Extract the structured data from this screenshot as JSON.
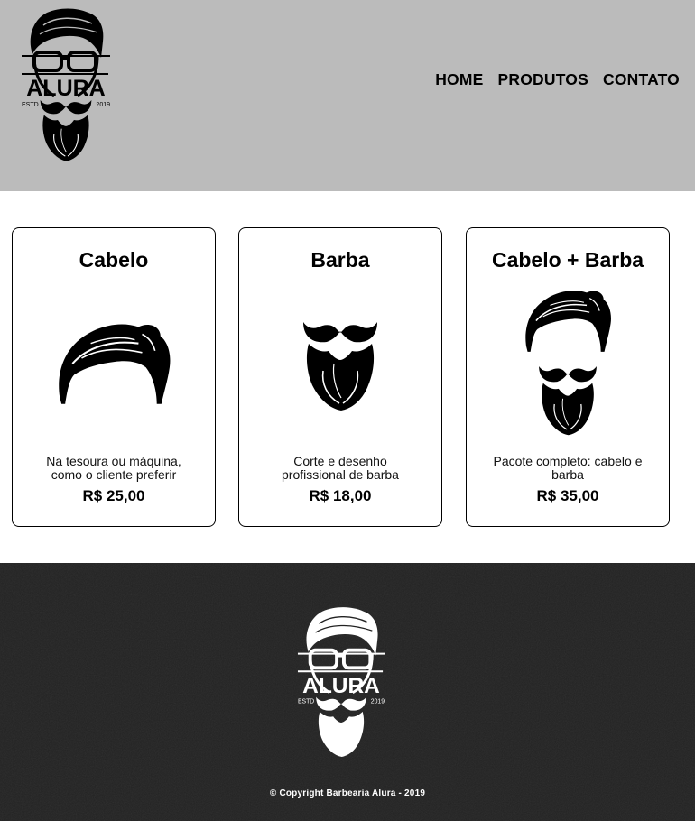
{
  "header": {
    "logo": {
      "brand": "ALURA",
      "estd_label": "ESTD",
      "year": "2019"
    },
    "nav": [
      {
        "label": "HOME"
      },
      {
        "label": "PRODUTOS"
      },
      {
        "label": "CONTATO"
      }
    ]
  },
  "products": [
    {
      "title": "Cabelo",
      "icon": "hair-icon",
      "description": "Na tesoura ou máquina, como o cliente preferir",
      "price": "R$ 25,00"
    },
    {
      "title": "Barba",
      "icon": "beard-icon",
      "description": "Corte e desenho profissional de barba",
      "price": "R$ 18,00"
    },
    {
      "title": "Cabelo + Barba",
      "icon": "hair-and-beard-icon",
      "description": "Pacote completo: cabelo e barba",
      "price": "R$ 35,00"
    }
  ],
  "footer": {
    "logo": {
      "brand": "ALURA",
      "estd_label": "ESTD",
      "year": "2019"
    },
    "copyright": "© Copyright Barbearia Alura - 2019"
  },
  "colors": {
    "header_bg": "#bbbbbb",
    "footer_bg": "#222222",
    "text": "#000000",
    "footer_text": "#ffffff"
  }
}
